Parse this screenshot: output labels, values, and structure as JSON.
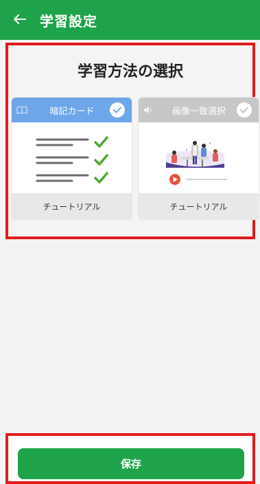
{
  "header": {
    "title": "学習設定",
    "back_icon": "arrow-left-icon"
  },
  "method_selection": {
    "title": "学習方法の選択",
    "cards": [
      {
        "label": "暗記カード",
        "footer": "チュートリアル",
        "selected": true,
        "header_color": "#6ea6ea",
        "header_icon": "book-icon"
      },
      {
        "label": "画像一致選択",
        "footer": "チュートリアル",
        "selected": false,
        "header_color": "#c7c7c7",
        "header_icon": "speaker-icon"
      }
    ]
  },
  "footer": {
    "save_label": "保存"
  },
  "colors": {
    "brand_green": "#1fa34a",
    "highlight_red": "#e11b1b"
  }
}
